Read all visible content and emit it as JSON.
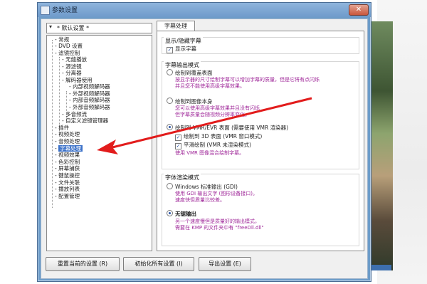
{
  "window": {
    "title": "参数设置",
    "close_glyph": "✕"
  },
  "profile_combo": {
    "value": "* 默认设置 *"
  },
  "tree": [
    {
      "label": "常规",
      "prefix": "-"
    },
    {
      "label": "DVD 设置",
      "prefix": "-"
    },
    {
      "label": "滤镜控制",
      "prefix": "-"
    },
    {
      "label": "无缝播放",
      "prefix": "-"
    },
    {
      "label": "源滤镜",
      "prefix": "-"
    },
    {
      "label": "分离器",
      "prefix": "-"
    },
    {
      "label": "解码器使用",
      "prefix": "-"
    },
    {
      "label": "内部视频解码器",
      "prefix": "-"
    },
    {
      "label": "外部视频解码器",
      "prefix": "-"
    },
    {
      "label": "内部音频解码器",
      "prefix": "-"
    },
    {
      "label": "外部音频解码器",
      "prefix": "-"
    },
    {
      "label": "多音频流",
      "prefix": "-"
    },
    {
      "label": "自定义滤镜管理器",
      "prefix": "-"
    },
    {
      "label": "插件",
      "prefix": "-"
    },
    {
      "label": "视频处理",
      "prefix": "-"
    },
    {
      "label": "音频处理",
      "prefix": "-"
    },
    {
      "label": "字幕处理",
      "prefix": "-"
    },
    {
      "label": "视频效果",
      "prefix": "-"
    },
    {
      "label": "色彩控制",
      "prefix": "-"
    },
    {
      "label": "屏幕捕获",
      "prefix": "-"
    },
    {
      "label": "键鼠操控",
      "prefix": "-"
    },
    {
      "label": "文件关联",
      "prefix": "-"
    },
    {
      "label": "播放列表",
      "prefix": "-"
    },
    {
      "label": "配置管理",
      "prefix": "-"
    }
  ],
  "selected_tree_item": "字幕处理",
  "tab": {
    "label": "字幕处理"
  },
  "groups": {
    "show_hide": {
      "title": "显示/隐藏字幕",
      "show_subtitle": "显示字幕"
    },
    "output_mode": {
      "title": "字幕输出模式",
      "opt1": "绘制到覆盖表面",
      "opt1_desc1": "按显示器的尺寸绘制字幕可以增加字幕的质量，但是它将有点闪烁",
      "opt1_desc2": "并且您不能使用高级字幕效果。",
      "opt2": "绘制到图像本身",
      "opt2_desc1": "您可以使用高级字幕效果并且没有闪烁",
      "opt2_desc2": "但字幕质量会随视频分辨率变化。",
      "opt3": "绘制到 VMR/EVR 表面 (需要使用 VMR 渲染器)",
      "opt3_sub1": "绘制到 3D 表面 (VMR 窗口模式)",
      "opt3_sub2": "平滑绘制 (VMR 未渲染模式)",
      "opt3_desc": "使用 VMR 图像混合绘制字幕。"
    },
    "render_mode": {
      "title": "字体渲染模式",
      "opt1": "Windows 标准输出 (GDI)",
      "opt1_desc1": "使用 GDI 输出文字 (图形设备接口)。",
      "opt1_desc2": "速度快但质量比较差。",
      "opt2": "无锯输出",
      "opt2_desc1": "另一个速度慢但是质量好的输出模式，",
      "opt2_desc2": "需要在 KMP 的文件夹中有 \"freeDll.dll\""
    }
  },
  "buttons": {
    "reset": "重置当前的设置 (R)",
    "init_all": "初始化所有设置 (I)",
    "export": "导出设置 (E)"
  },
  "colors": {
    "title_bar": "#6f9bcb",
    "selection": "#3e73c9",
    "desc_text": "#a0299a",
    "annotation_arrow": "#e21c1c"
  }
}
